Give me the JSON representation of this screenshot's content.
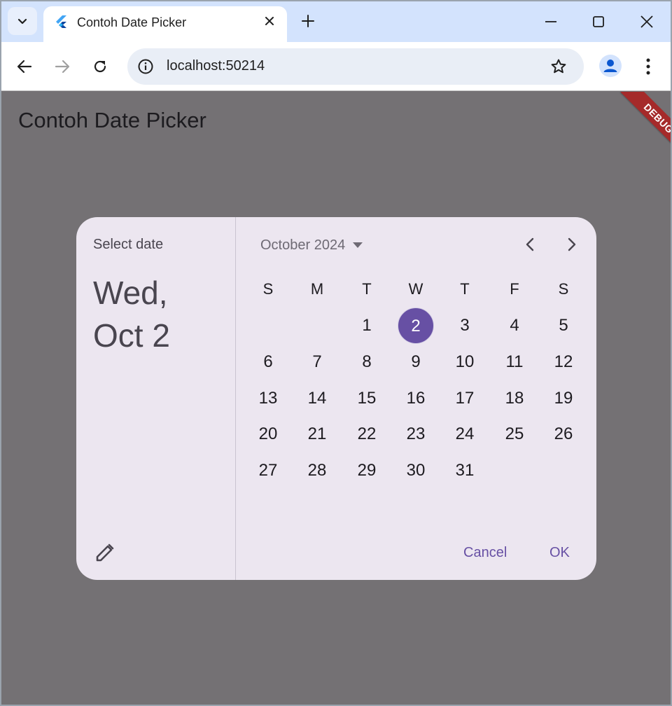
{
  "browser": {
    "tab_title": "Contoh Date Picker",
    "url": "localhost:50214"
  },
  "app": {
    "title": "Contoh Date Picker",
    "debug_banner": "DEBUG"
  },
  "dialog": {
    "help_text": "Select date",
    "headline_line1": "Wed,",
    "headline_line2": "Oct 2",
    "month_label": "October 2024",
    "weekdays": [
      "S",
      "M",
      "T",
      "W",
      "T",
      "F",
      "S"
    ],
    "days": [
      "1",
      "2",
      "3",
      "4",
      "5",
      "6",
      "7",
      "8",
      "9",
      "10",
      "11",
      "12",
      "13",
      "14",
      "15",
      "16",
      "17",
      "18",
      "19",
      "20",
      "21",
      "22",
      "23",
      "24",
      "25",
      "26",
      "27",
      "28",
      "29",
      "30",
      "31"
    ],
    "first_weekday_index": 2,
    "selected_day": "2",
    "cancel_label": "Cancel",
    "ok_label": "OK"
  },
  "colors": {
    "scrim": "#747174",
    "dialog_bg": "#ece6f0",
    "accent": "#6750a4",
    "debug": "#a52a2a"
  }
}
